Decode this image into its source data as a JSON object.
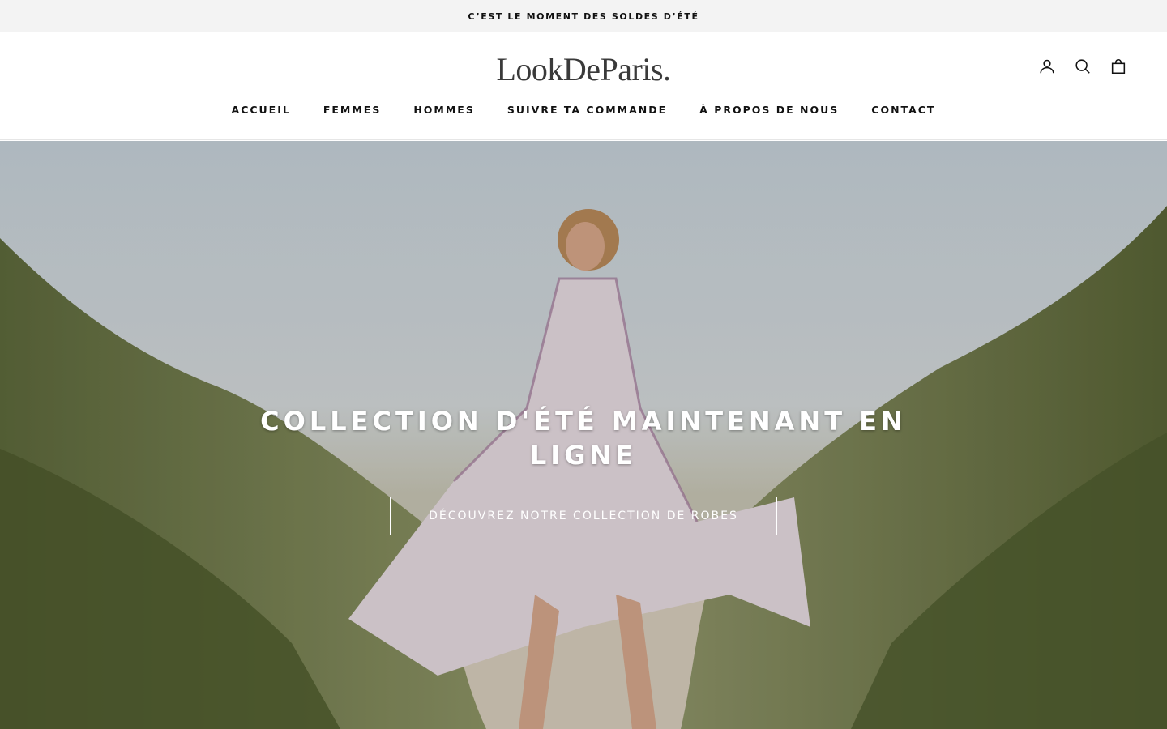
{
  "announcement": {
    "text": "C’EST LE MOMENT DES SOLDES D’ÉTÉ"
  },
  "header": {
    "logo": "LookDeParis.",
    "icons": [
      "account-icon",
      "search-icon",
      "cart-icon"
    ]
  },
  "nav": {
    "items": [
      {
        "label": "ACCUEIL"
      },
      {
        "label": "FEMMES"
      },
      {
        "label": "HOMMES"
      },
      {
        "label": "SUIVRE TA COMMANDE"
      },
      {
        "label": "À PROPOS DE NOUS"
      },
      {
        "label": "CONTACT"
      }
    ]
  },
  "hero": {
    "title": "COLLECTION D'ÉTÉ MAINTENANT EN LIGNE",
    "button_label": "DÉCOUVREZ NOTRE COLLECTION DE ROBES"
  },
  "colors": {
    "announcement_bg": "#f3f3f3",
    "text": "#111111",
    "logo": "#3a3a3a",
    "hero_text": "#ffffff"
  }
}
